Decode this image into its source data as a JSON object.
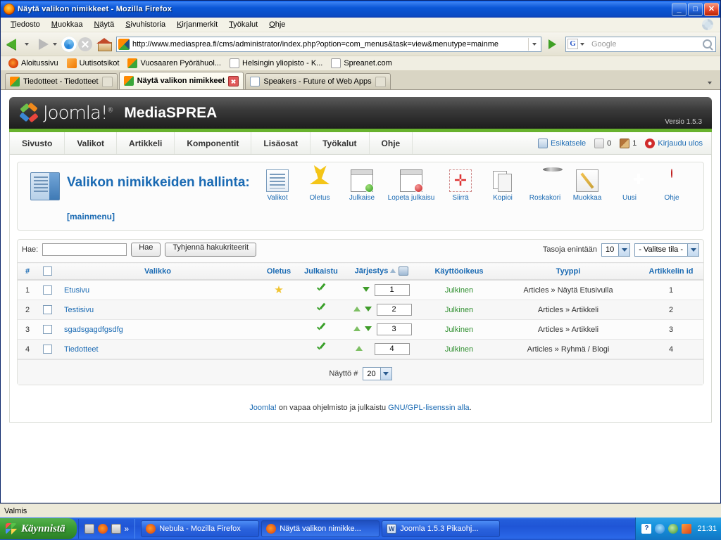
{
  "window": {
    "title": "Näytä valikon nimikkeet - Mozilla Firefox",
    "minimize": "_",
    "maximize": "□",
    "close": "✕"
  },
  "menubar": [
    {
      "label": "Tiedosto"
    },
    {
      "label": "Muokkaa"
    },
    {
      "label": "Näytä"
    },
    {
      "label": "Sivuhistoria"
    },
    {
      "label": "Kirjanmerkit"
    },
    {
      "label": "Työkalut"
    },
    {
      "label": "Ohje"
    }
  ],
  "navbar": {
    "url": "http://www.mediasprea.fi/cms/administrator/index.php?option=com_menus&task=view&menutype=mainme",
    "search_placeholder": "Google",
    "search_engine": "G"
  },
  "bookmarks": [
    {
      "label": "Aloitussivu",
      "icon": "fox"
    },
    {
      "label": "Uutisotsikot",
      "icon": "rss"
    },
    {
      "label": "Vuosaaren Pyörähuol...",
      "icon": "joomla"
    },
    {
      "label": "Helsingin yliopisto - K...",
      "icon": "page"
    },
    {
      "label": "Spreanet.com",
      "icon": "page"
    }
  ],
  "tabs": [
    {
      "label": "Tiedotteet - Tiedotteet",
      "icon": "joomla",
      "active": false
    },
    {
      "label": "Näytä valikon nimikkeet",
      "icon": "joomla",
      "active": true
    },
    {
      "label": "Speakers - Future of Web Apps",
      "icon": "page",
      "active": false
    }
  ],
  "joomla": {
    "logo_text": "Joomla!",
    "logo_tm": "®",
    "site_name": "MediaSPREA",
    "version": "Versio 1.5.3",
    "menu": [
      {
        "label": "Sivusto"
      },
      {
        "label": "Valikot"
      },
      {
        "label": "Artikkeli"
      },
      {
        "label": "Komponentit"
      },
      {
        "label": "Lisäosat"
      },
      {
        "label": "Työkalut"
      },
      {
        "label": "Ohje"
      }
    ],
    "menu_right": {
      "preview": "Esikatsele",
      "messages_count": "0",
      "users_count": "1",
      "logout": "Kirjaudu ulos"
    },
    "page_title": "Valikon nimikkeiden hallinta:",
    "menutype": "[mainmenu]",
    "toolbar": [
      {
        "label": "Valikot",
        "icon": "menus-icon"
      },
      {
        "label": "Oletus",
        "icon": "star-icon"
      },
      {
        "label": "Julkaise",
        "icon": "publish-icon"
      },
      {
        "label": "Lopeta julkaisu",
        "icon": "unpublish-icon"
      },
      {
        "label": "Siirrä",
        "icon": "move-icon"
      },
      {
        "label": "Kopioi",
        "icon": "copy-icon"
      },
      {
        "label": "Roskakori",
        "icon": "trash-icon"
      },
      {
        "label": "Muokkaa",
        "icon": "edit-icon"
      },
      {
        "label": "Uusi",
        "icon": "new-icon"
      },
      {
        "label": "Ohje",
        "icon": "help-icon"
      }
    ],
    "filter": {
      "search_label": "Hae:",
      "search_value": "",
      "search_button": "Hae",
      "reset_button": "Tyhjennä hakukriteerit",
      "levels_label": "Tasoja enintään",
      "levels_value": "10",
      "state_value": "- Valitse tila -"
    },
    "table": {
      "columns": [
        "#",
        "",
        "Valikko",
        "Oletus",
        "Julkaistu",
        "Järjestys",
        "Käyttöoikeus",
        "Tyyppi",
        "Artikkelin id"
      ],
      "sort_column": "Järjestys",
      "rows": [
        {
          "num": "1",
          "name": "Etusivu",
          "default": true,
          "published": true,
          "order_up": false,
          "order_down": true,
          "order_value": "1",
          "access": "Julkinen",
          "type": "Articles » Näytä Etusivulla",
          "article_id": "1"
        },
        {
          "num": "2",
          "name": "Testisivu",
          "default": false,
          "published": true,
          "order_up": true,
          "order_down": true,
          "order_value": "2",
          "access": "Julkinen",
          "type": "Articles » Artikkeli",
          "article_id": "2"
        },
        {
          "num": "3",
          "name": "sgadsgagdfgsdfg",
          "default": false,
          "published": true,
          "order_up": true,
          "order_down": true,
          "order_value": "3",
          "access": "Julkinen",
          "type": "Articles » Artikkeli",
          "article_id": "3"
        },
        {
          "num": "4",
          "name": "Tiedotteet",
          "default": false,
          "published": true,
          "order_up": true,
          "order_down": false,
          "order_value": "4",
          "access": "Julkinen",
          "type": "Articles » Ryhmä / Blogi",
          "article_id": "4"
        }
      ]
    },
    "pager": {
      "label": "Näyttö #",
      "value": "20"
    },
    "credit": {
      "brand": "Joomla!",
      "text": " on vapaa ohjelmisto ja julkaistu ",
      "link": "GNU/GPL-lisenssin alla",
      "end": "."
    }
  },
  "statusbar": {
    "text": "Valmis"
  },
  "taskbar": {
    "start": "Käynnistä",
    "quicklaunch_more": "»",
    "tasks": [
      {
        "label": "Nebula - Mozilla Firefox",
        "icon": "fox",
        "active": false
      },
      {
        "label": "Näytä valikon nimikke...",
        "icon": "fox",
        "active": true
      },
      {
        "label": "Joomla 1.5.3 Pikaohj...",
        "icon": "word",
        "active": false
      }
    ],
    "tray_question": "?",
    "clock": "21:31"
  }
}
